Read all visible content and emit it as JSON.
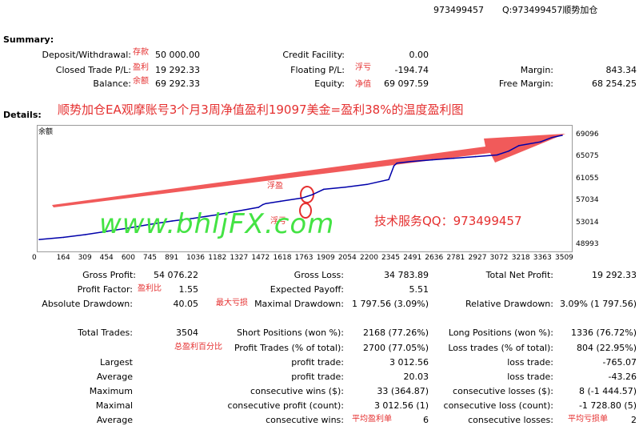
{
  "header": {
    "account": "973499457",
    "qq": "Q:973499457顺势加仓"
  },
  "summary": {
    "title": "Summary:",
    "deposit_label": "Deposit/Withdrawal:",
    "deposit_note": "存款",
    "deposit_value": "50 000.00",
    "credit_label": "Credit Facility:",
    "credit_value": "0.00",
    "closed_label": "Closed Trade P/L:",
    "closed_note": "盈利",
    "closed_value": "19 292.33",
    "floating_label": "Floating P/L:",
    "floating_note": "浮亏",
    "floating_value": "-194.74",
    "margin_label": "Margin:",
    "margin_value": "843.34",
    "balance_label": "Balance:",
    "balance_note": "余额",
    "balance_value": "69 292.33",
    "equity_label": "Equity:",
    "equity_note": "净值",
    "equity_value": "69 097.59",
    "free_margin_label": "Free Margin:",
    "free_margin_value": "68 254.25"
  },
  "details": {
    "label": "Details:",
    "headline": "顺势加仓EA观摩账号3个月3周净值盈利19097美金=盈利38%的温度盈利图"
  },
  "chart_annot": {
    "corner": "余额",
    "float_profit": "浮盈",
    "float_loss": "浮亏",
    "watermark": "www.bhljFX.com",
    "service": "技术服务QQ：973499457"
  },
  "chart_data": {
    "type": "line",
    "x_ticks": [
      "0",
      "164",
      "309",
      "454",
      "600",
      "745",
      "891",
      "1036",
      "1182",
      "1327",
      "1472",
      "1618",
      "1763",
      "1909",
      "2054",
      "2200",
      "2345",
      "2491",
      "2636",
      "2781",
      "2927",
      "3072",
      "3218",
      "3363",
      "3509"
    ],
    "y_ticks": [
      "69096",
      "65075",
      "61055",
      "57034",
      "53014",
      "48993"
    ],
    "ylim": [
      48993,
      69096
    ],
    "xlim": [
      0,
      3509
    ],
    "series": [
      {
        "color": "#0000aa",
        "x": [
          0,
          164,
          309,
          454,
          600,
          745,
          891,
          1036,
          1182,
          1327,
          1472,
          1500,
          1520,
          1618,
          1763,
          1830,
          1909,
          2054,
          2200,
          2345,
          2380,
          2400,
          2491,
          2636,
          2781,
          2927,
          3072,
          3150,
          3218,
          3363,
          3440,
          3509
        ],
        "y": [
          50000,
          50400,
          50900,
          51500,
          52100,
          52800,
          53400,
          53900,
          54500,
          55200,
          55900,
          56400,
          56600,
          57000,
          57600,
          58200,
          59200,
          59600,
          60100,
          61000,
          63500,
          64000,
          64300,
          64600,
          64900,
          65200,
          65500,
          66200,
          67200,
          67900,
          68700,
          69097
        ]
      }
    ]
  },
  "stats": {
    "gross_profit_label": "Gross Profit:",
    "gross_profit_value": "54 076.22",
    "gross_loss_label": "Gross Loss:",
    "gross_loss_value": "34 783.89",
    "total_net_label": "Total Net Profit:",
    "total_net_value": "19 292.33",
    "profit_factor_label": "Profit Factor:",
    "profit_factor_note": "盈利比",
    "profit_factor_value": "1.55",
    "expected_label": "Expected Payoff:",
    "expected_value": "5.51",
    "abs_dd_label": "Absolute Drawdown:",
    "abs_dd_value": "40.05",
    "max_dd_note": "最大亏损",
    "max_dd_label": "Maximal Drawdown:",
    "max_dd_value": "1 797.56 (3.09%)",
    "rel_dd_label": "Relative Drawdown:",
    "rel_dd_value": "3.09% (1 797.56)",
    "total_trades_label": "Total Trades:",
    "total_trades_value": "3504",
    "short_label": "Short Positions (won %):",
    "short_value": "2168 (77.26%)",
    "long_label": "Long Positions (won %):",
    "long_value": "1336 (76.72%)",
    "profit_pct_note": "总盈利百分比",
    "profit_trades_label": "Profit Trades (% of total):",
    "profit_trades_value": "2700 (77.05%)",
    "loss_trades_label": "Loss trades (% of total):",
    "loss_trades_value": "804 (22.95%)",
    "largest_label": "Largest",
    "largest_profit_label": "profit trade:",
    "largest_profit_value": "3 012.56",
    "largest_loss_label": "loss trade:",
    "largest_loss_value": "-765.07",
    "average_label": "Average",
    "average_profit_label": "profit trade:",
    "average_profit_value": "20.03",
    "average_loss_label": "loss trade:",
    "average_loss_value": "-43.26",
    "maximum_label": "Maximum",
    "max_wins_label": "consecutive wins ($):",
    "max_wins_value": "33 (364.87)",
    "max_losses_label": "consecutive losses ($):",
    "max_losses_value": "8 (-1 444.57)",
    "maximal_label": "Maximal",
    "max_profit_label": "consecutive profit (count):",
    "max_profit_value": "3 012.56 (1)",
    "max_loss_label": "consecutive loss (count):",
    "max_loss_value": "-1 728.80 (5)",
    "avg2_label": "Average",
    "avg_wins_label": "consecutive wins:",
    "avg_wins_note": "平均盈利单",
    "avg_wins_value": "6",
    "avg_losses_label": "consecutive losses:",
    "avg_losses_note": "平均亏损单",
    "avg_losses_value": "2"
  }
}
